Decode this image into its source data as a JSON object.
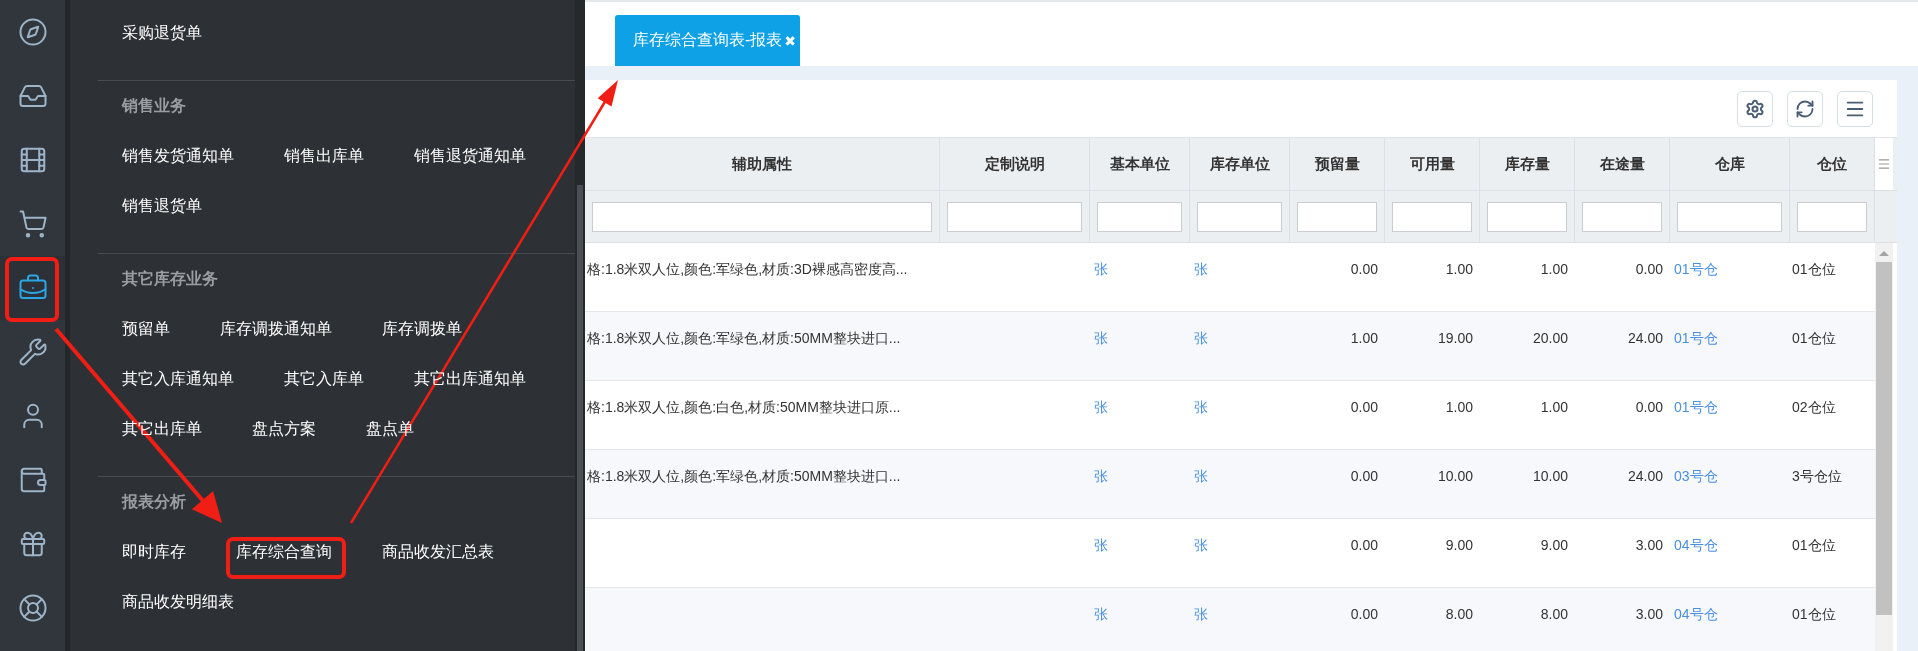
{
  "rail": [
    {
      "selected": false
    },
    {
      "selected": false
    },
    {
      "selected": false
    },
    {
      "selected": false
    },
    {
      "selected": true
    },
    {
      "selected": false
    },
    {
      "selected": false
    },
    {
      "selected": false
    },
    {
      "selected": false
    },
    {
      "selected": false
    }
  ],
  "menu": {
    "sections": [
      {
        "items": [
          "采购退货单"
        ]
      },
      {
        "title": "销售业务",
        "items": [
          "销售发货通知单",
          "销售出库单",
          "销售退货通知单",
          "销售退货单"
        ]
      },
      {
        "title": "其它库存业务",
        "items": [
          "预留单",
          "库存调拨通知单",
          "库存调拨单",
          "其它入库通知单",
          "其它入库单",
          "其它出库通知单",
          "其它出库单",
          "盘点方案",
          "盘点单"
        ]
      },
      {
        "title": "报表分析",
        "items": [
          "即时库存",
          "库存综合查询",
          "商品收发汇总表",
          "商品收发明细表"
        ]
      }
    ]
  },
  "tabs": [
    {
      "label": "库存综合查询表-报表",
      "close": "✖",
      "selected": true
    }
  ],
  "table": {
    "columns": [
      {
        "label": "辅助属性",
        "kind": "text"
      },
      {
        "label": "定制说明",
        "kind": "text"
      },
      {
        "label": "基本单位",
        "kind": "link"
      },
      {
        "label": "库存单位",
        "kind": "link"
      },
      {
        "label": "预留量",
        "kind": "number"
      },
      {
        "label": "可用量",
        "kind": "number"
      },
      {
        "label": "库存量",
        "kind": "number"
      },
      {
        "label": "在途量",
        "kind": "number"
      },
      {
        "label": "仓库",
        "kind": "link"
      },
      {
        "label": "仓位",
        "kind": "text"
      }
    ],
    "rows": [
      {
        "attr": "格:1.8米双人位,颜色:军绿色,材质:3D裸感高密度高...",
        "base_unit": "张",
        "stock_unit": "张",
        "reserved": "0.00",
        "available": "1.00",
        "stock": "1.00",
        "in_transit": "0.00",
        "warehouse": "01号仓",
        "location": "01仓位"
      },
      {
        "attr": "格:1.8米双人位,颜色:军绿色,材质:50MM整块进口...",
        "base_unit": "张",
        "stock_unit": "张",
        "reserved": "1.00",
        "available": "19.00",
        "stock": "20.00",
        "in_transit": "24.00",
        "warehouse": "01号仓",
        "location": "01仓位"
      },
      {
        "attr": "格:1.8米双人位,颜色:白色,材质:50MM整块进口原...",
        "base_unit": "张",
        "stock_unit": "张",
        "reserved": "0.00",
        "available": "1.00",
        "stock": "1.00",
        "in_transit": "0.00",
        "warehouse": "01号仓",
        "location": "02仓位"
      },
      {
        "attr": "格:1.8米双人位,颜色:军绿色,材质:50MM整块进口...",
        "base_unit": "张",
        "stock_unit": "张",
        "reserved": "0.00",
        "available": "10.00",
        "stock": "10.00",
        "in_transit": "24.00",
        "warehouse": "03号仓",
        "location": "3号仓位"
      },
      {
        "base_unit": "张",
        "stock_unit": "张",
        "reserved": "0.00",
        "available": "9.00",
        "stock": "9.00",
        "in_transit": "3.00",
        "warehouse": "04号仓",
        "location": "01仓位"
      },
      {
        "base_unit": "张",
        "stock_unit": "张",
        "reserved": "0.00",
        "available": "8.00",
        "stock": "8.00",
        "in_transit": "3.00",
        "warehouse": "04号仓",
        "location": "01仓位"
      }
    ]
  }
}
